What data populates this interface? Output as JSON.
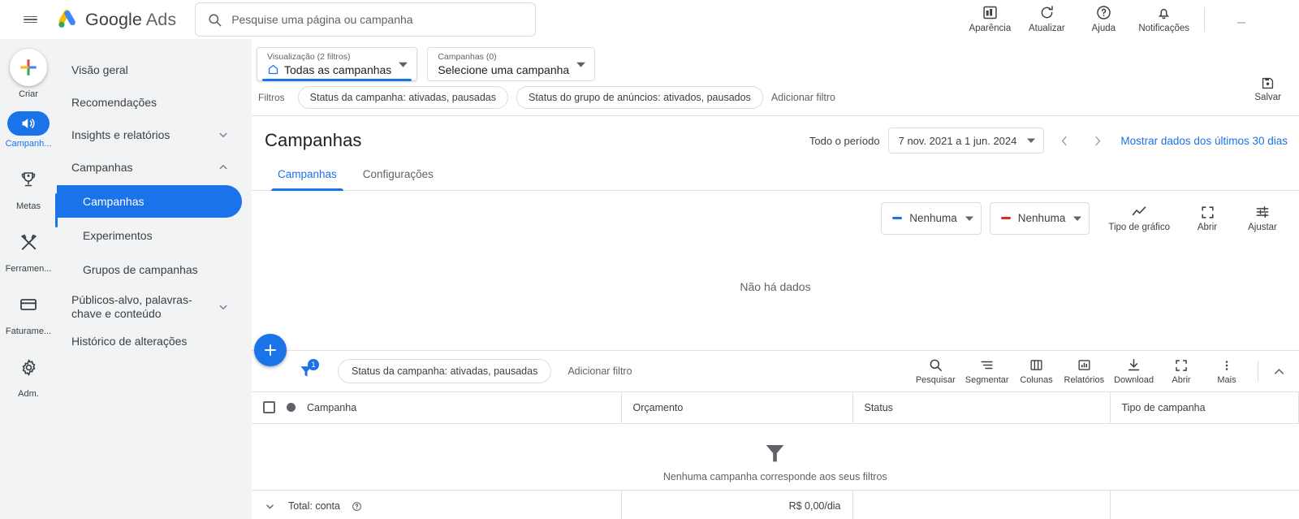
{
  "topbar": {
    "menu_icon": "hamburger-icon",
    "brand_google": "Google",
    "brand_ads": "Ads",
    "search_placeholder": "Pesquise uma página ou campanha",
    "search_value": "",
    "actions": [
      {
        "label": "Aparência",
        "icon": "appearance-icon"
      },
      {
        "label": "Atualizar",
        "icon": "refresh-icon"
      },
      {
        "label": "Ajuda",
        "icon": "help-icon"
      },
      {
        "label": "Notificações",
        "icon": "bell-icon"
      }
    ]
  },
  "rail": {
    "items": [
      {
        "label": "Criar",
        "icon": "plus-icon",
        "active": false
      },
      {
        "label": "Campanh...",
        "icon": "megaphone-icon",
        "active": true
      },
      {
        "label": "Metas",
        "icon": "trophy-icon",
        "active": false
      },
      {
        "label": "Ferramen...",
        "icon": "tools-icon",
        "active": false
      },
      {
        "label": "Faturame...",
        "icon": "billing-card-icon",
        "active": false
      },
      {
        "label": "Adm.",
        "icon": "gear-icon",
        "active": false
      }
    ]
  },
  "nav": {
    "items": [
      {
        "label": "Visão geral",
        "expandable": false
      },
      {
        "label": "Recomendações",
        "expandable": false
      },
      {
        "label": "Insights e relatórios",
        "expandable": true,
        "expanded": false
      },
      {
        "label": "Campanhas",
        "expandable": true,
        "expanded": true
      }
    ],
    "subitems": [
      {
        "label": "Campanhas",
        "active": true
      },
      {
        "label": "Experimentos",
        "active": false
      },
      {
        "label": "Grupos de campanhas",
        "active": false
      }
    ],
    "items_after": [
      {
        "label": "Públicos-alvo, palavras-chave e conteúdo",
        "expandable": true,
        "expanded": false
      },
      {
        "label": "Histórico de alterações",
        "expandable": false
      }
    ]
  },
  "selectors": {
    "view": {
      "caption": "Visualização (2 filtros)",
      "value": "Todas as campanhas",
      "icon": "home-icon"
    },
    "campaign": {
      "caption": "Campanhas (0)",
      "value": "Selecione uma campanha"
    }
  },
  "filters": {
    "label": "Filtros",
    "chips": [
      "Status da campanha: ativadas, pausadas",
      "Status do grupo de anúncios: ativados, pausados"
    ],
    "add_label": "Adicionar filtro",
    "save_label": "Salvar",
    "save_icon": "save-disk-icon"
  },
  "page": {
    "title": "Campanhas",
    "date_label": "Todo o período",
    "date_value": "7 nov. 2021 a 1 jun. 2024",
    "prev_icon": "chevron-left-icon",
    "next_icon": "chevron-right-icon",
    "date_link": "Mostrar dados dos últimos 30 dias"
  },
  "tabs": [
    {
      "label": "Campanhas",
      "active": true
    },
    {
      "label": "Configurações",
      "active": false
    }
  ],
  "chart": {
    "metric_a": {
      "label": "Nenhuma",
      "color": "#1a73e8"
    },
    "metric_b": {
      "label": "Nenhuma",
      "color": "#d93025"
    },
    "buttons": [
      {
        "label": "Tipo de gráfico",
        "icon": "line-chart-icon"
      },
      {
        "label": "Abrir",
        "icon": "expand-icon"
      },
      {
        "label": "Ajustar",
        "icon": "tune-icon"
      }
    ],
    "empty_text": "Não há dados"
  },
  "chart_data": {
    "type": "line",
    "title": "",
    "series": [
      {
        "name": "Nenhuma",
        "color": "#1a73e8",
        "values": []
      },
      {
        "name": "Nenhuma",
        "color": "#d93025",
        "values": []
      }
    ],
    "x": [],
    "categories": [],
    "values": [],
    "xlabel": "",
    "ylabel": "",
    "grid": false,
    "legend": "top-right",
    "empty_message": "Não há dados"
  },
  "table_toolbar": {
    "fab_icon": "plus-icon",
    "funnel_icon": "filter-funnel-icon",
    "funnel_badge": "1",
    "chip": "Status da campanha: ativadas, pausadas",
    "add_label": "Adicionar filtro",
    "buttons": [
      {
        "label": "Pesquisar",
        "icon": "search-icon"
      },
      {
        "label": "Segmentar",
        "icon": "segment-icon"
      },
      {
        "label": "Colunas",
        "icon": "columns-icon"
      },
      {
        "label": "Relatórios",
        "icon": "reports-bar-icon"
      },
      {
        "label": "Download",
        "icon": "download-icon"
      },
      {
        "label": "Abrir",
        "icon": "expand-icon"
      },
      {
        "label": "Mais",
        "icon": "more-vert-icon"
      }
    ],
    "collapse_icon": "chevron-up-icon"
  },
  "table": {
    "columns": [
      "Campanha",
      "Orçamento",
      "Status",
      "Tipo de campanha"
    ],
    "rows": [],
    "empty_icon": "filter-funnel-icon",
    "empty_text": "Nenhuma campanha corresponde aos seus filtros",
    "total_label": "Total: conta",
    "total_help_icon": "help-circle-icon",
    "total_budget": "R$ 0,00/dia",
    "expand_icon": "chevron-down-icon"
  }
}
